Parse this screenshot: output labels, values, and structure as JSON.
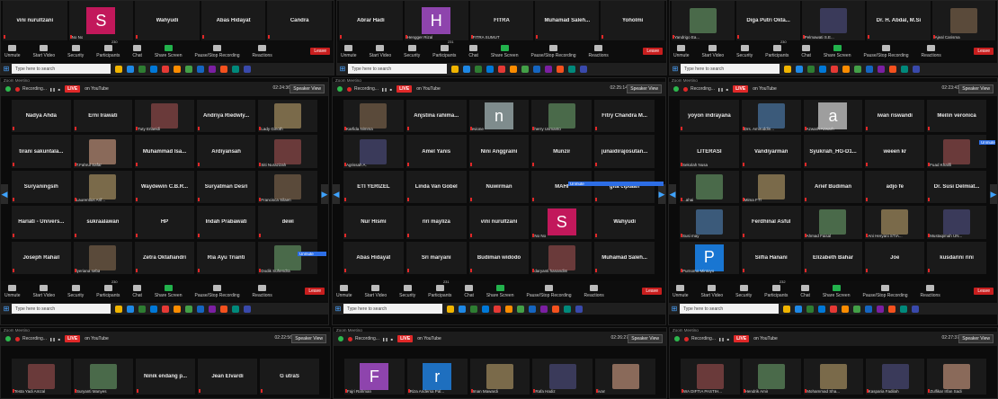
{
  "colors": {
    "live": "#e02828",
    "share": "#22b24c",
    "unmute": "#2d6ee6",
    "leave": "#c81e1e",
    "tile": "#1a1a1a",
    "bg": "#0b0b0b"
  },
  "common": {
    "window_title": "Zoom Meeting",
    "recording": "Recording...",
    "live": "LIVE",
    "youtube": "on YouTube",
    "speaker_view": "Speaker View",
    "leave": "Leave",
    "search_placeholder": "Type here to search",
    "unmute": "Unmute"
  },
  "controls": [
    {
      "label": "Unmute",
      "icon": "mic-muted-icon"
    },
    {
      "label": "Start Video",
      "icon": "video-off-icon"
    },
    {
      "label": "Security",
      "icon": "shield-icon"
    },
    {
      "label": "Participants",
      "icon": "participants-icon"
    },
    {
      "label": "Chat",
      "icon": "chat-icon"
    },
    {
      "label": "Share Screen",
      "icon": "share-screen-icon"
    },
    {
      "label": "Pause/Stop Recording",
      "icon": "recording-icon"
    },
    {
      "label": "Reactions",
      "icon": "reactions-icon"
    }
  ],
  "panels": {
    "top_left": {
      "tiles": [
        "vini nurultzani",
        "S",
        "Wahyudi",
        "Abas Hidayat",
        "Candra"
      ],
      "caps": [
        "",
        "No No",
        "",
        "",
        ""
      ],
      "participants": "230"
    },
    "top_mid": {
      "tiles": [
        "Abrar Hadi",
        "H",
        "FITRA",
        "Muhamad Saleh...",
        "Yoholmi"
      ],
      "caps": [
        "",
        "Hengger Rizal",
        "FITRA SUMUT",
        "",
        ""
      ],
      "participants": "231"
    },
    "top_right": {
      "tiles": [
        "",
        "Diga Putri Okta...",
        "",
        "Dr. H. Abdal, M.Si",
        ""
      ],
      "caps": [
        "Yandrigo Ea...",
        "",
        "Pelmawati S.E...",
        "",
        "Ajeal Carisma"
      ],
      "participants": "230"
    },
    "mid_left": {
      "timer": "02:24:36",
      "participants": "230",
      "tiles": [
        {
          "n": "Nadya Ahda",
          "c": ""
        },
        {
          "n": "Erni Irawati",
          "c": ""
        },
        {
          "n": "",
          "c": "Tuty Erlaeidi"
        },
        {
          "n": "Andriya Riedwly...",
          "c": ""
        },
        {
          "n": "",
          "c": "Lady Ginoth"
        },
        {
          "n": "tirani sakuntala...",
          "c": ""
        },
        {
          "n": "",
          "c": "T.Fahrul Safar"
        },
        {
          "n": "Muhammad Isa...",
          "c": ""
        },
        {
          "n": "Ardiyansah",
          "c": ""
        },
        {
          "n": "",
          "c": "Siti Nurazizah"
        },
        {
          "n": "Suryaningsih",
          "c": ""
        },
        {
          "n": "",
          "c": "Laurentius Arif..."
        },
        {
          "n": "Waydewin C.B.R...",
          "c": ""
        },
        {
          "n": "Suryatman Desri",
          "c": ""
        },
        {
          "n": "",
          "c": "Francisca Silaen"
        },
        {
          "n": "Hariati - Univers...",
          "c": ""
        },
        {
          "n": "sukraalawan",
          "c": ""
        },
        {
          "n": "HP",
          "c": ""
        },
        {
          "n": "Indah Prabawati",
          "c": ""
        },
        {
          "n": "dewi",
          "c": ""
        },
        {
          "n": "Joseph Rahail",
          "c": ""
        },
        {
          "n": "",
          "c": "lyeriana seba"
        },
        {
          "n": "Zetra Oktafiandri",
          "c": ""
        },
        {
          "n": "Ria Ayu Trianti",
          "c": ""
        },
        {
          "n": "",
          "c": "Dodik Suhendra"
        }
      ]
    },
    "mid_mid": {
      "timer": "02:25:14",
      "participants": "231",
      "tiles": [
        {
          "n": "",
          "c": "Karfida Nimma"
        },
        {
          "n": "Anjstina rahima...",
          "c": ""
        },
        {
          "n": "n",
          "c": "evione"
        },
        {
          "n": "",
          "c": "herry Usmanto"
        },
        {
          "n": "Fitry Chandra M...",
          "c": ""
        },
        {
          "n": "",
          "c": "Agrissah A."
        },
        {
          "n": "Amel Yanis",
          "c": ""
        },
        {
          "n": "Nini Anggraini",
          "c": ""
        },
        {
          "n": "Munzir",
          "c": ""
        },
        {
          "n": "junaidirajosutan...",
          "c": ""
        },
        {
          "n": "ETI YERIZEL",
          "c": ""
        },
        {
          "n": "Linda Van Gobel",
          "c": ""
        },
        {
          "n": "Nuwirman",
          "c": ""
        },
        {
          "n": "MAHI",
          "c": ""
        },
        {
          "n": "gita ciptaan",
          "c": ""
        },
        {
          "n": "Nur Hismi",
          "c": ""
        },
        {
          "n": "riri mayliza",
          "c": ""
        },
        {
          "n": "vini nurultzani",
          "c": ""
        },
        {
          "n": "S",
          "c": "No No"
        },
        {
          "n": "Wahyudi",
          "c": ""
        },
        {
          "n": "Abas Hidayat",
          "c": ""
        },
        {
          "n": "Sri maryani",
          "c": ""
        },
        {
          "n": "Budiman widodo",
          "c": ""
        },
        {
          "n": "",
          "c": "daryanti hanandim"
        },
        {
          "n": "Muhamad Saleh...",
          "c": ""
        }
      ]
    },
    "mid_right": {
      "timer": "02:23:41",
      "participants": "232",
      "tiles": [
        {
          "n": "yoyon indrayana",
          "c": ""
        },
        {
          "n": "",
          "c": "Drs. Amiruddin..."
        },
        {
          "n": "a",
          "c": "Azwarh Azwarh"
        },
        {
          "n": "iwan riswandi",
          "c": ""
        },
        {
          "n": "Meilin veronica",
          "c": ""
        },
        {
          "n": "LITERASI",
          "c": "Sekolah Nusa"
        },
        {
          "n": "Vandiyarman",
          "c": ""
        },
        {
          "n": "Syukriah_HG-D1...",
          "c": ""
        },
        {
          "n": "weeen kr",
          "c": ""
        },
        {
          "n": "",
          "c": "Fuad Khalifi"
        },
        {
          "n": "",
          "c": "...ahai"
        },
        {
          "n": "",
          "c": "Mima FTI"
        },
        {
          "n": "Arief Budiman",
          "c": ""
        },
        {
          "n": "adjo fe",
          "c": ""
        },
        {
          "n": "Dr. Susi Delmiat...",
          "c": ""
        },
        {
          "n": "",
          "c": "Susi may"
        },
        {
          "n": "Ferdhinal Asful",
          "c": ""
        },
        {
          "n": "",
          "c": "Ahmad Faisal"
        },
        {
          "n": "",
          "c": "Ani Heryani STIA..."
        },
        {
          "n": "",
          "c": "Mustaqimah UN..."
        },
        {
          "n": "P",
          "c": "Purnomo Mintoyo"
        },
        {
          "n": "Silfia Hanani",
          "c": ""
        },
        {
          "n": "Elizabeth Bahar",
          "c": ""
        },
        {
          "n": "Joe",
          "c": ""
        },
        {
          "n": "kusdarini rini",
          "c": ""
        }
      ]
    },
    "bot_left": {
      "timer": "02:22:56",
      "tiles": [
        {
          "n": "",
          "c": "Testa Yadi Amzal"
        },
        {
          "n": "",
          "c": "Suryanti Manyes"
        },
        {
          "n": "Ninik endang p...",
          "c": ""
        },
        {
          "n": "Jean Elvardi",
          "c": ""
        },
        {
          "n": "G utraS",
          "c": ""
        }
      ]
    },
    "bot_mid": {
      "timer": "02:26:27",
      "tiles": [
        {
          "n": "F",
          "c": "Fajri Rahman"
        },
        {
          "n": "r",
          "c": "Riza Andersa Pal..."
        },
        {
          "n": "",
          "c": "Iman Mawardi"
        },
        {
          "n": "",
          "c": "Rafa Hadiz"
        },
        {
          "n": "",
          "c": "ivan"
        }
      ]
    },
    "bot_right": {
      "timer": "02:27:37",
      "tiles": [
        {
          "n": "",
          "c": "WA DIFTIA PASTIH..."
        },
        {
          "n": "",
          "c": "Hendrik Amir"
        },
        {
          "n": "",
          "c": "Mohammad Sha..."
        },
        {
          "n": "",
          "c": "Kasparia Fadilah"
        },
        {
          "n": "",
          "c": "Zulfikar Irfan Sadi"
        }
      ]
    }
  }
}
